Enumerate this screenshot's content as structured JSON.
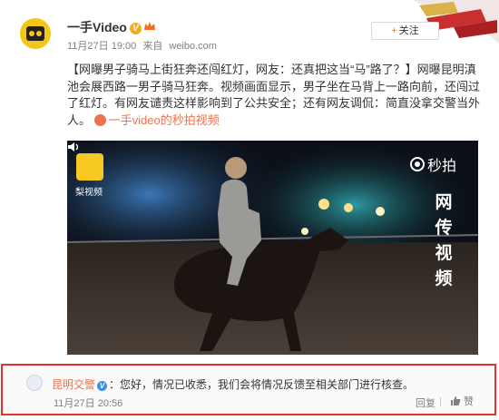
{
  "post": {
    "user_name": "一手Video",
    "timestamp": "11月27日 19:00",
    "source_prefix": "来自",
    "source": "weibo.com",
    "follow_plus": "+",
    "follow_label": "关注",
    "text_headline": "【网曝男子骑马上街狂奔还闯红灯，网友：还真把这当“马”路了？】",
    "text_body": "网曝昆明滇池会展西路一男子骑马狂奔。视频画面显示，男子坐在马背上一路向前，还闯过了红灯。有网友谴责这样影响到了公共安全；还有网友调侃：简直没拿交警当外人。",
    "video_link": "一手video的秒拍视频",
    "video": {
      "left_logo_text": "梨视频",
      "right_logo_text": "秒拍",
      "vertical_text": [
        "网",
        "传",
        "视",
        "频"
      ]
    }
  },
  "comment": {
    "user_name": "昆明交警",
    "text": "：您好，情况已收悉，我们会将情况反馈至相关部门进行核查。",
    "timestamp": "11月27日 20:56",
    "reply_label": "回复",
    "like_label": "赞"
  },
  "colors": {
    "accent": "#eb7350",
    "highlight_border": "#e8312b",
    "verified_orange": "#f2ac1c",
    "verified_blue": "#3c8fe4"
  }
}
